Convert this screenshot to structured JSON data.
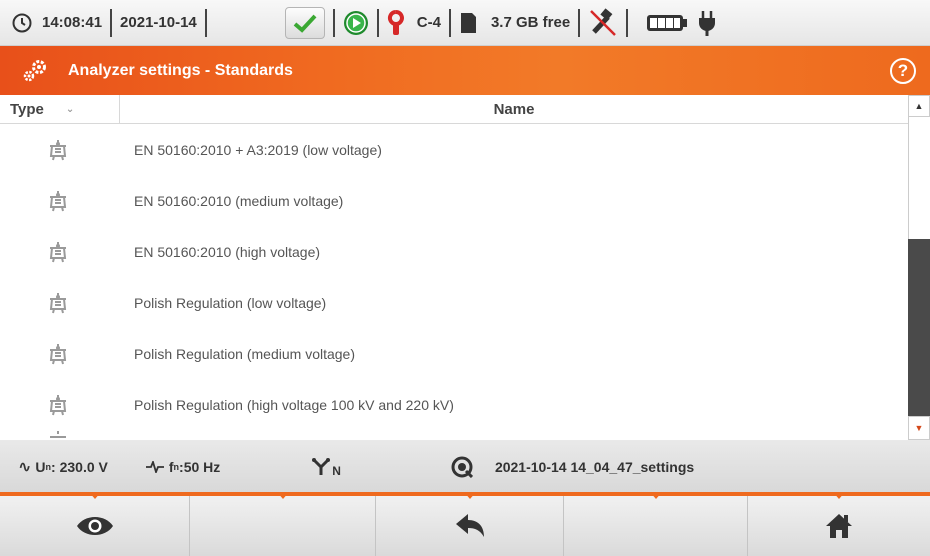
{
  "status": {
    "time": "14:08:41",
    "date": "2021-10-14",
    "clamp_label": "C-4",
    "storage_free": "3.7 GB free",
    "icons": [
      "clock-icon",
      "checkmark-icon",
      "recording-play-icon",
      "clamp-icon",
      "sd-card-icon",
      "usb-disconnected-icon",
      "battery-icon",
      "power-plug-icon"
    ]
  },
  "titlebar": {
    "title": "Analyzer settings - Standards",
    "help_label": "?"
  },
  "table": {
    "columns": [
      {
        "key": "type",
        "label": "Type"
      },
      {
        "key": "name",
        "label": "Name"
      }
    ],
    "rows": [
      {
        "type_icon": "standard-icon",
        "name": "EN 50160:2010 + A3:2019 (low voltage)"
      },
      {
        "type_icon": "standard-icon",
        "name": "EN 50160:2010 (medium voltage)"
      },
      {
        "type_icon": "standard-icon",
        "name": "EN 50160:2010 (high voltage)"
      },
      {
        "type_icon": "standard-icon",
        "name": "Polish Regulation (low voltage)"
      },
      {
        "type_icon": "standard-icon",
        "name": "Polish Regulation (medium voltage)"
      },
      {
        "type_icon": "standard-icon",
        "name": "Polish Regulation (high voltage 100 kV and 220 kV)"
      }
    ]
  },
  "infobar": {
    "voltage": "U",
    "voltage_sub": "n",
    "voltage_value": ": 230.0 V",
    "freq": "f",
    "freq_sub": "n",
    "freq_value": ":50 Hz",
    "network_sub": "N",
    "settings_file": "2021-10-14 14_04_47_settings"
  },
  "bottombar": {
    "buttons": [
      "eye-icon",
      "",
      "back-arrow-icon",
      "",
      "home-icon"
    ]
  },
  "colors": {
    "accent": "#ef6a1e",
    "ok_green": "#3aa832",
    "clamp_red": "#d62828"
  }
}
